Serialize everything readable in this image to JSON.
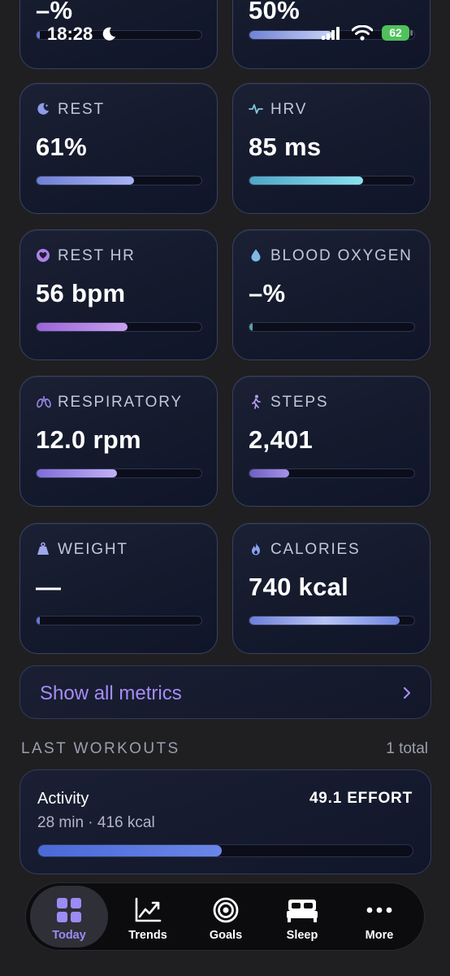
{
  "status_bar": {
    "time": "18:28",
    "battery": "62"
  },
  "top_partial": {
    "left_value": "–%",
    "right_value": "50%",
    "left_progress": 0.02,
    "right_progress": 0.5
  },
  "metrics": [
    {
      "id": "rest",
      "label": "REST",
      "value": "61%",
      "progress": 0.59,
      "icon": "moon-icon",
      "color": "#8f9ae8"
    },
    {
      "id": "hrv",
      "label": "HRV",
      "value": "85 ms",
      "progress": 0.69,
      "icon": "pulse-icon",
      "color": "#6fd0e6"
    },
    {
      "id": "rest_hr",
      "label": "REST HR",
      "value": "56 bpm",
      "progress": 0.55,
      "icon": "heart-icon",
      "color": "#b380e6"
    },
    {
      "id": "blood_oxygen",
      "label": "BLOOD OXYGEN",
      "value": "–%",
      "progress": 0.02,
      "icon": "drop-icon",
      "color": "#5fb0c0"
    },
    {
      "id": "respiratory",
      "label": "RESPIRATORY",
      "value": "12.0 rpm",
      "progress": 0.49,
      "icon": "lungs-icon",
      "color": "#9e86ea"
    },
    {
      "id": "steps",
      "label": "STEPS",
      "value": "2,401",
      "progress": 0.24,
      "icon": "walking-icon",
      "color": "#8e7bd8"
    },
    {
      "id": "weight",
      "label": "WEIGHT",
      "value": "—",
      "progress": 0.02,
      "icon": "weight-icon",
      "color": "#6a78d8"
    },
    {
      "id": "calories",
      "label": "CALORIES",
      "value": "740 kcal",
      "progress": 0.91,
      "icon": "flame-icon",
      "color": "#8d9de8"
    }
  ],
  "show_all": {
    "label": "Show all metrics"
  },
  "workouts_section": {
    "title": "LAST WORKOUTS",
    "count": "1 total",
    "items": [
      {
        "name": "Activity",
        "effort": "49.1 EFFORT",
        "meta": "28 min · 416 kcal",
        "progress": 0.49
      }
    ]
  },
  "tabbar": {
    "active": "today",
    "tabs": [
      {
        "id": "today",
        "label": "Today",
        "icon": "grid-icon"
      },
      {
        "id": "trends",
        "label": "Trends",
        "icon": "trend-chart-icon"
      },
      {
        "id": "goals",
        "label": "Goals",
        "icon": "target-icon"
      },
      {
        "id": "sleep",
        "label": "Sleep",
        "icon": "bed-icon"
      },
      {
        "id": "more",
        "label": "More",
        "icon": "more-dots-icon"
      }
    ]
  }
}
